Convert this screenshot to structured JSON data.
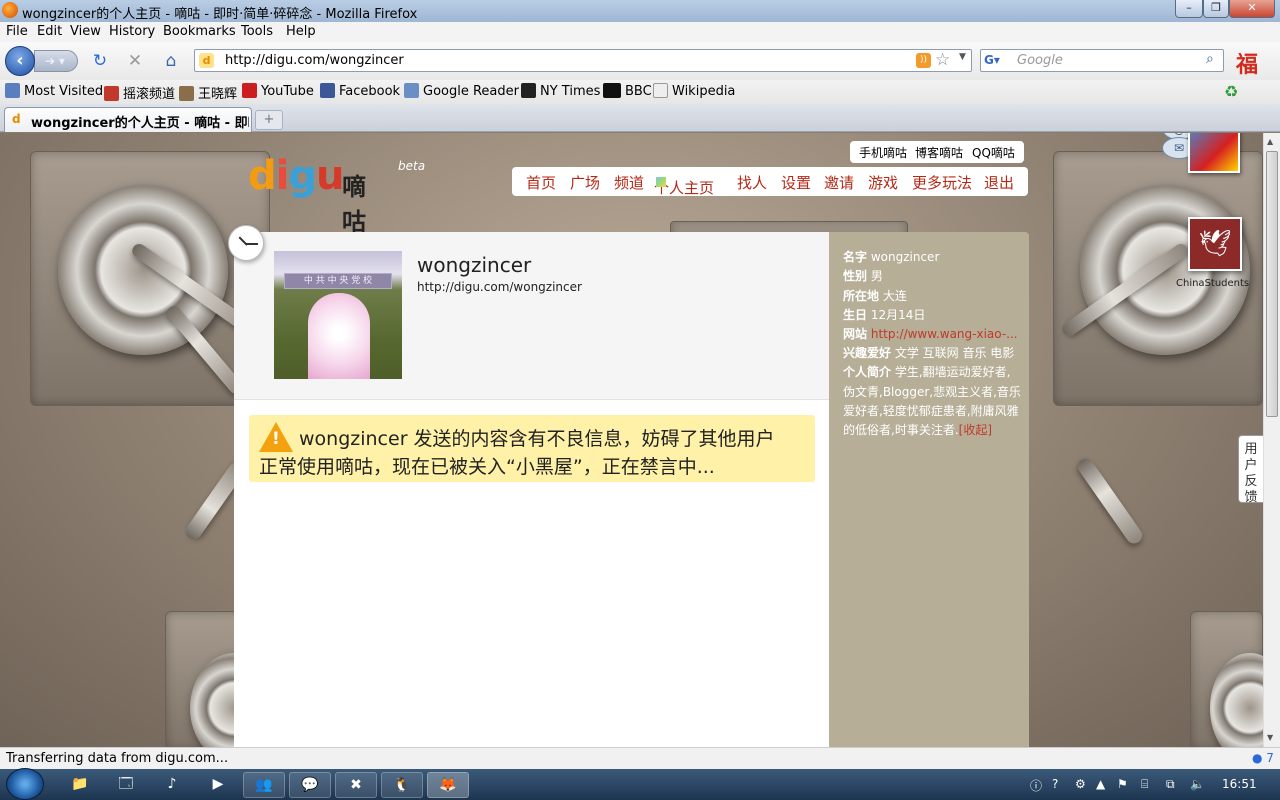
{
  "window": {
    "title": "wongzincer的个人主页 - 嘀咕 - 即时·简单·碎碎念 - Mozilla Firefox",
    "controls": [
      "minimize",
      "maximize",
      "close"
    ]
  },
  "menu": [
    "File",
    "Edit",
    "View",
    "History",
    "Bookmarks",
    "Tools",
    "Help"
  ],
  "nav": {
    "url": "http://digu.com/wongzincer",
    "search_placeholder": "Google"
  },
  "bookmarks": [
    {
      "label": "Most Visited",
      "icon": "most-visited-icon"
    },
    {
      "label": "摇滚频道",
      "icon": "rock-channel-icon"
    },
    {
      "label": "王晓辉",
      "icon": "person-icon"
    },
    {
      "label": "YouTube",
      "icon": "youtube-icon"
    },
    {
      "label": "Facebook",
      "icon": "facebook-icon"
    },
    {
      "label": "Google Reader",
      "icon": "google-reader-icon"
    },
    {
      "label": "NY Times",
      "icon": "nytimes-icon"
    },
    {
      "label": "BBC",
      "icon": "bbc-icon"
    },
    {
      "label": "Wikipedia",
      "icon": "wikipedia-icon"
    }
  ],
  "tab": {
    "label": "wongzincer的个人主页 - 嘀咕 - 即时..."
  },
  "site": {
    "logo": {
      "brand": "digu",
      "cn": "嘀咕",
      "beta": "beta"
    },
    "top_links": [
      "手机嘀咕",
      "博客嘀咕",
      "QQ嘀咕"
    ],
    "nav_menu": [
      "首页",
      "广场",
      "频道",
      "个人主页",
      "找人",
      "设置",
      "邀请",
      "游戏",
      "更多玩法",
      "退出"
    ]
  },
  "profile": {
    "username": "wongzincer",
    "url": "http://digu.com/wongzincer",
    "avatar_sign_text": "中 共 中 央 党 校"
  },
  "warning": {
    "line1": "wongzincer 发送的内容含有不良信息，妨碍了其他用户",
    "line2": "正常使用嘀咕，现在已被关入“小黑屋”，正在禁言中..."
  },
  "sidebar": {
    "name_label": "名字",
    "name_value": "wongzincer",
    "gender_label": "性别",
    "gender_value": "男",
    "location_label": "所在地",
    "location_value": "大连",
    "birthday_label": "生日",
    "birthday_value": "12月14日",
    "website_label": "网站",
    "website_value": "http://www.wang-xiao-...",
    "interests_label": "兴趣爱好",
    "interests_value": "文学 互联网 音乐 电影",
    "bio_label": "个人简介",
    "bio_line1": "学生,翻墙运动爱好者,",
    "bio_line2": "伪文青,Blogger,悲观主义者,音乐",
    "bio_line3": "爱好者,轻度忧郁症患者,附庸风雅",
    "bio_line4": "的低俗者,时事关注者.",
    "collapse": "[收起]"
  },
  "widgets": {
    "feedback": "用户反馈",
    "twitter_label": "ChinaStudents"
  },
  "status": {
    "text": "Transferring data from digu.com...",
    "badge": "7"
  },
  "taskbar": {
    "clock": "16:51"
  }
}
